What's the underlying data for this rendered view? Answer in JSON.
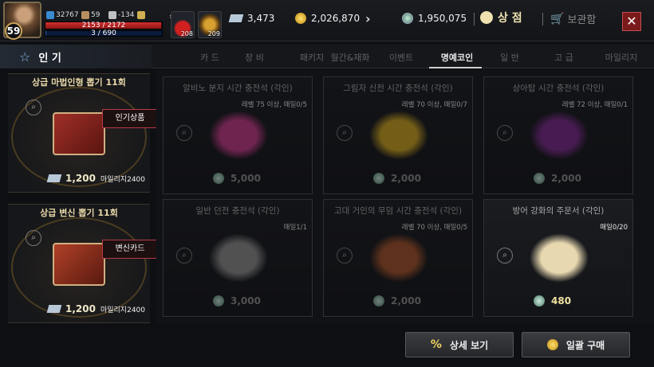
{
  "player": {
    "level": "59",
    "power": "32767",
    "stat_a": "59",
    "stat_b": "-134",
    "hp": "2153 / 2172",
    "hp_fraction": 0.991,
    "mp": "3 / 690",
    "mp_fraction": 0.004
  },
  "quick_slots": [
    {
      "name": "potion-slot",
      "count": "208"
    },
    {
      "name": "scroll-slot",
      "count": "209"
    }
  ],
  "currencies": [
    {
      "name": "mileage",
      "value": "3,473",
      "icon": "ticket-icon"
    },
    {
      "name": "gold",
      "value": "2,026,870",
      "icon": "gold-coin-icon"
    },
    {
      "name": "honor-coin",
      "value": "1,950,075",
      "icon": "honor-coin-icon"
    }
  ],
  "header": {
    "shop_label": "상 점",
    "storage_label": "보관함",
    "close_label": "✕"
  },
  "tabs": {
    "favorites_label": "인 기",
    "items": [
      "카 드",
      "장 비",
      "패키지",
      "월간&재화",
      "이벤트",
      "명예코인",
      "일 반",
      "고 급",
      "마일리지"
    ],
    "active_index": 5
  },
  "left_panel": [
    {
      "title": "상급 마법인형 뽑기 11회",
      "badge": "인기상품",
      "price": "1,200",
      "mileage": "마일리지2400"
    },
    {
      "title": "상급 변신 뽑기 11회",
      "badge": "변신카드",
      "price": "1,200",
      "mileage": "마일리지2400"
    }
  ],
  "items": [
    {
      "name": "알비노 분지 시간 충전석 (각인)",
      "condition": "레벨 75 이상, 매일0/5",
      "price": "5,000",
      "color": "#c23a88",
      "dim": true
    },
    {
      "name": "그림자 신전 시간 충전석 (각인)",
      "condition": "레벨 70 이상, 매일0/7",
      "price": "2,000",
      "color": "#c8a020",
      "dim": true
    },
    {
      "name": "상아탑 시간 충전석 (각인)",
      "condition": "레벨 72 이상, 매일0/1",
      "price": "2,000",
      "color": "#7a2a8a",
      "dim": true
    },
    {
      "name": "일반 던전 충전석 (각인)",
      "condition": "매일1/1",
      "price": "3,000",
      "color": "#8a8a8a",
      "dim": true
    },
    {
      "name": "고대 거인의 무덤 시간 충전석 (각인)",
      "condition": "레벨 70 이상, 매일0/5",
      "price": "2,000",
      "color": "#a0502a",
      "dim": true
    },
    {
      "name": "방어 강화의 주문서 (각인)",
      "condition": "매일0/20",
      "price": "480",
      "color": "#e8d8b0",
      "dim": false
    }
  ],
  "footer": {
    "detail_label": "상세 보기",
    "bulk_buy_label": "일괄 구매"
  }
}
